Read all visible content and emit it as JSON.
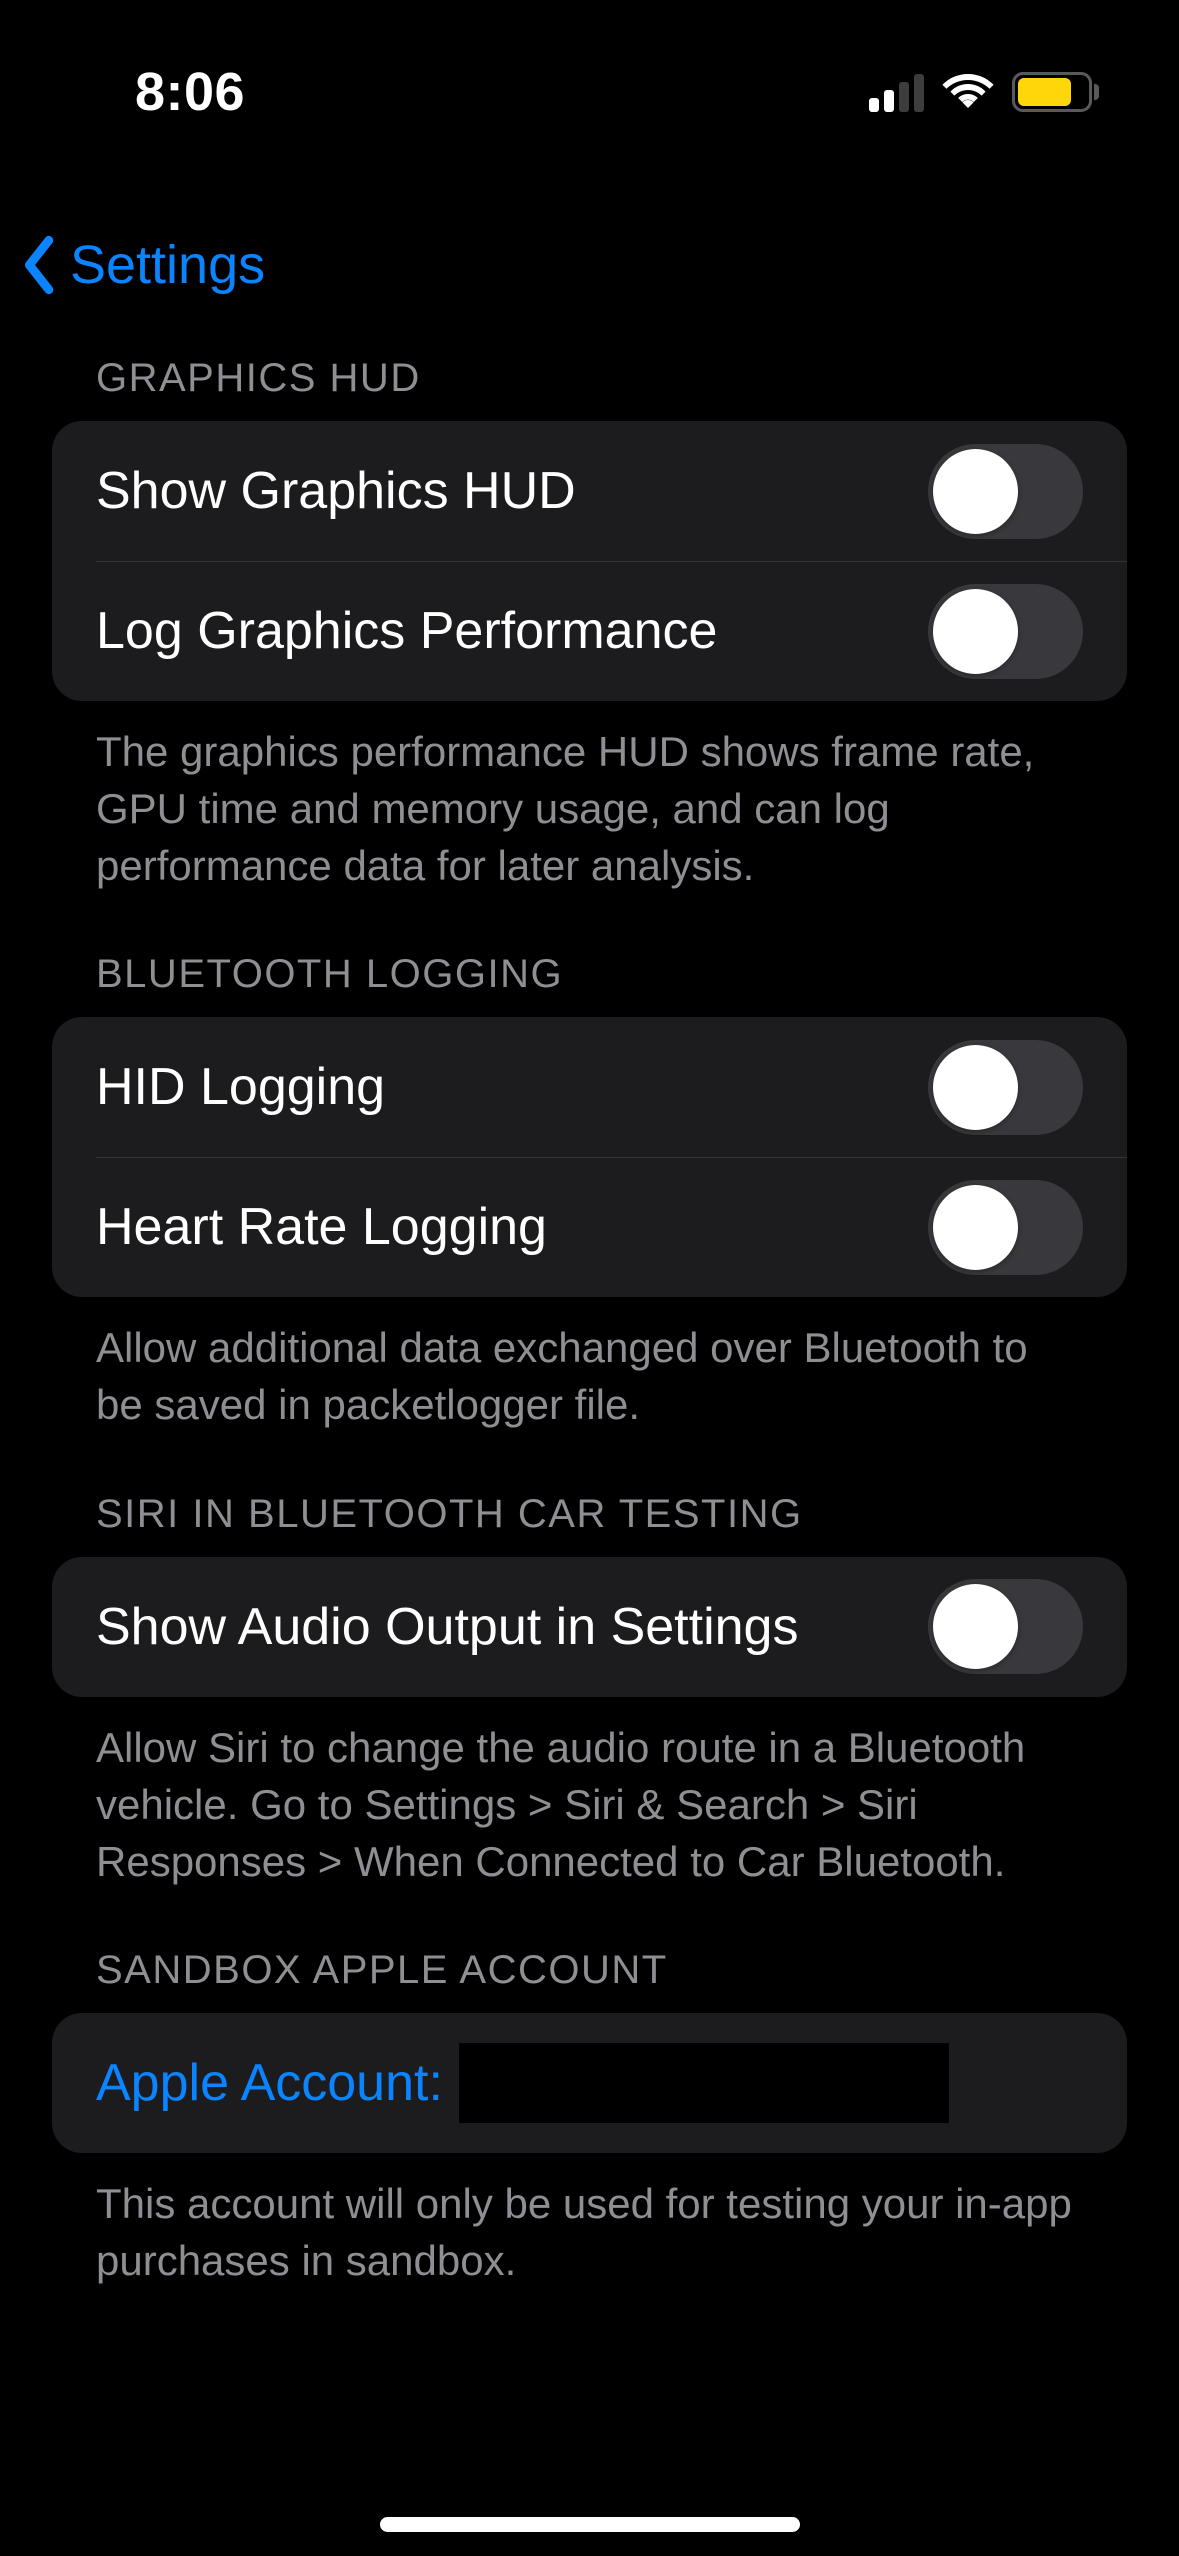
{
  "status": {
    "time": "8:06",
    "cell_signal_bars_active": 2,
    "cell_signal_bars_total": 4,
    "battery_low_power": true
  },
  "nav": {
    "back_label": "Settings"
  },
  "sections": [
    {
      "header": "GRAPHICS HUD",
      "footer": "The graphics performance HUD shows frame rate, GPU time and memory usage, and can log performance data for later analysis.",
      "rows": [
        {
          "label": "Show Graphics HUD",
          "type": "switch",
          "value": false
        },
        {
          "label": "Log Graphics Performance",
          "type": "switch",
          "value": false
        }
      ]
    },
    {
      "header": "BLUETOOTH LOGGING",
      "footer": "Allow additional data exchanged over Bluetooth to be saved in packetlogger file.",
      "rows": [
        {
          "label": "HID Logging",
          "type": "switch",
          "value": false
        },
        {
          "label": "Heart Rate Logging",
          "type": "switch",
          "value": false
        }
      ]
    },
    {
      "header": "SIRI IN BLUETOOTH CAR TESTING",
      "footer": "Allow Siri to change the audio route in a Bluetooth vehicle. Go to Settings > Siri & Search > Siri Responses > When Connected to Car Bluetooth.",
      "rows": [
        {
          "label": "Show Audio Output in Settings",
          "type": "switch",
          "value": false
        }
      ]
    },
    {
      "header": "SANDBOX APPLE ACCOUNT",
      "footer": "This account will only be used for testing your in-app purchases in sandbox.",
      "rows": [
        {
          "label": "Apple Account:",
          "type": "link_redacted"
        }
      ]
    }
  ]
}
